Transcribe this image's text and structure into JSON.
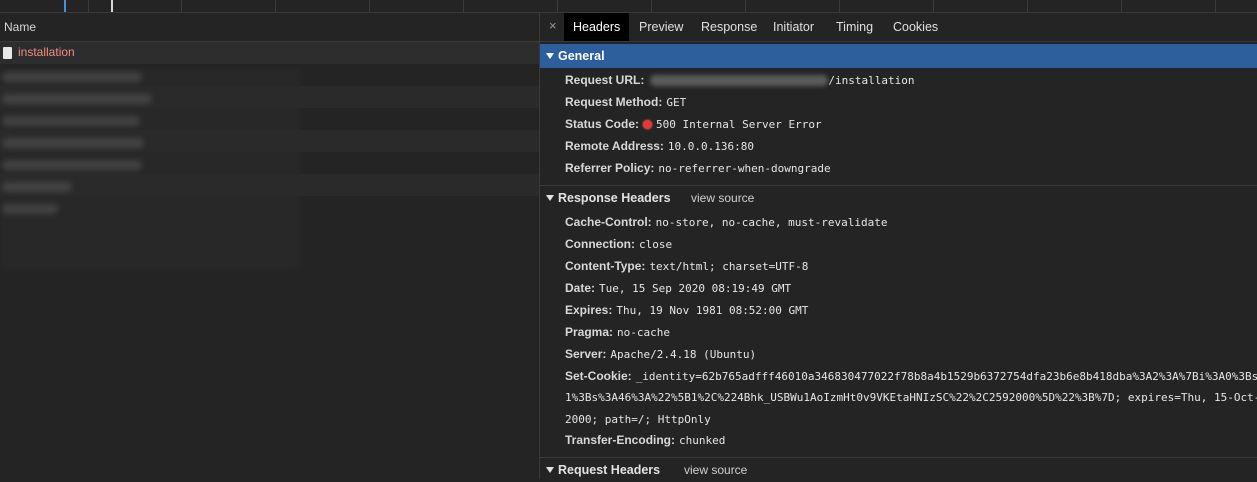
{
  "list": {
    "header": "Name",
    "selected_item": "installation"
  },
  "tabs": [
    "Headers",
    "Preview",
    "Response",
    "Initiator",
    "Timing",
    "Cookies"
  ],
  "close_symbol": "×",
  "general": {
    "title": "General",
    "request_url_label": "Request URL:",
    "request_url_suffix": "/installation",
    "request_method_label": "Request Method:",
    "request_method": "GET",
    "status_code_label": "Status Code:",
    "status_code": "500 Internal Server Error",
    "remote_address_label": "Remote Address:",
    "remote_address": "10.0.0.136:80",
    "referrer_policy_label": "Referrer Policy:",
    "referrer_policy": "no-referrer-when-downgrade"
  },
  "response_headers": {
    "title": "Response Headers",
    "view_source": "view source",
    "items": [
      {
        "key": "Cache-Control:",
        "value": "no-store, no-cache, must-revalidate"
      },
      {
        "key": "Connection:",
        "value": "close"
      },
      {
        "key": "Content-Type:",
        "value": "text/html; charset=UTF-8"
      },
      {
        "key": "Date:",
        "value": "Tue, 15 Sep 2020 08:19:49 GMT"
      },
      {
        "key": "Expires:",
        "value": "Thu, 19 Nov 1981 08:52:00 GMT"
      },
      {
        "key": "Pragma:",
        "value": "no-cache"
      },
      {
        "key": "Server:",
        "value": "Apache/2.4.18 (Ubuntu)"
      }
    ],
    "set_cookie_label": "Set-Cookie:",
    "set_cookie_line1": "_identity=62b765adfff46010a346830477022f78b8a4b1529b6372754dfa23b6e8b418dba%3A2%3A%7Bi%3A0%3Bs",
    "set_cookie_line2": "1%3Bs%3A46%3A%22%5B1%2C%224Bhk_USBWu1AoIzmHt0v9VKEtaHNIzSC%22%2C2592000%5D%22%3B%7D; expires=Thu, 15-Oct-",
    "set_cookie_line3": "2000; path=/; HttpOnly",
    "transfer_encoding_label": "Transfer-Encoding:",
    "transfer_encoding": "chunked"
  },
  "request_headers": {
    "title": "Request Headers",
    "view_source": "view source"
  },
  "colors": {
    "background": "#242424",
    "selected_section": "#2d5f9e",
    "error_label": "#f28b82",
    "status_dot": "#e53935"
  }
}
